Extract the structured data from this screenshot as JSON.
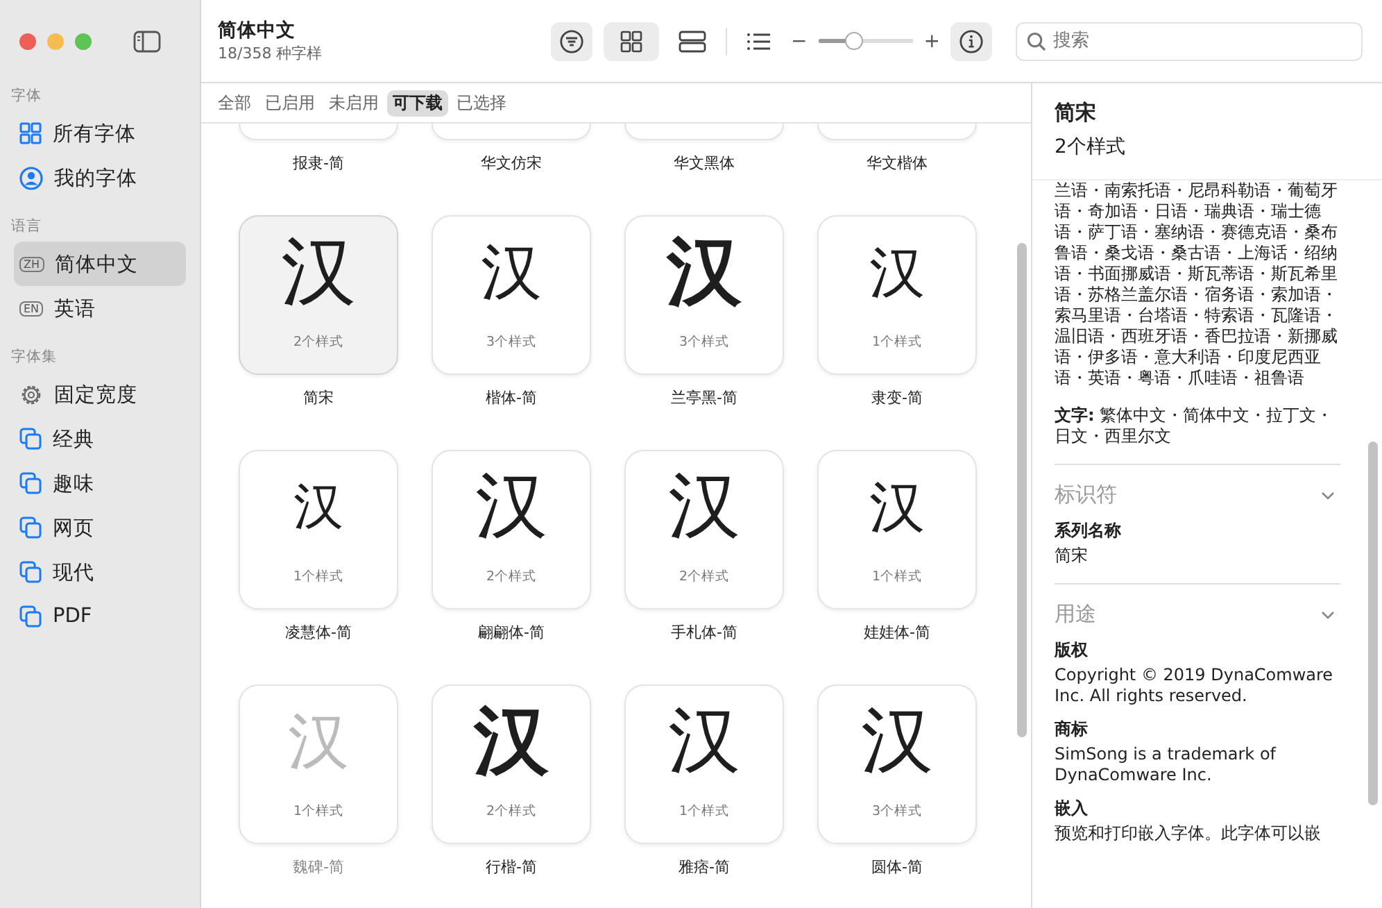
{
  "window": {
    "controls": [
      {
        "color": "#ee5f57"
      },
      {
        "color": "#f5bd4f"
      },
      {
        "color": "#5ec454"
      }
    ]
  },
  "sidebar": {
    "sections": [
      {
        "title": "字体",
        "items": [
          {
            "label": "所有字体",
            "kind": "grid",
            "selected": false
          },
          {
            "label": "我的字体",
            "kind": "person",
            "selected": false
          }
        ]
      },
      {
        "title": "语言",
        "items": [
          {
            "label": "简体中文",
            "kind": "badge",
            "badge": "ZH",
            "selected": true
          },
          {
            "label": "英语",
            "kind": "badge",
            "badge": "EN",
            "selected": false
          }
        ]
      },
      {
        "title": "字体集",
        "items": [
          {
            "label": "固定宽度",
            "kind": "gear",
            "selected": false
          },
          {
            "label": "经典",
            "kind": "collection",
            "selected": false
          },
          {
            "label": "趣味",
            "kind": "collection",
            "selected": false
          },
          {
            "label": "网页",
            "kind": "collection",
            "selected": false
          },
          {
            "label": "现代",
            "kind": "collection",
            "selected": false
          },
          {
            "label": "PDF",
            "kind": "collection",
            "selected": false
          }
        ]
      }
    ]
  },
  "toolbar": {
    "title": "简体中文",
    "subtitle": "18/358 种字样",
    "buttons": [
      {
        "kind": "filter",
        "on": true
      },
      {
        "kind": "grid",
        "on": true
      },
      {
        "kind": "rows",
        "on": false
      },
      {
        "kind": "list",
        "on": false
      }
    ],
    "size_slider": {
      "minus": "−",
      "plus": "+",
      "level": 0.38
    },
    "info_button": {
      "on": true
    },
    "search": {
      "placeholder": "搜索"
    }
  },
  "tabs": [
    {
      "label": "全部",
      "selected": false
    },
    {
      "label": "已启用",
      "selected": false
    },
    {
      "label": "未启用",
      "selected": false
    },
    {
      "label": "可下载",
      "selected": true
    },
    {
      "label": "已选择",
      "selected": false
    }
  ],
  "grid": {
    "cut_row": [
      {
        "name": "报隶-简"
      },
      {
        "name": "华文仿宋"
      },
      {
        "name": "华文黑体"
      },
      {
        "name": "华文楷体"
      }
    ],
    "cards": [
      {
        "sample": "汉",
        "kind": "song",
        "styles": "2个样式",
        "name": "简宋",
        "selected": true,
        "disabled": false
      },
      {
        "sample": "汉",
        "kind": "kai",
        "styles": "3个样式",
        "name": "楷体-简",
        "selected": false,
        "disabled": false
      },
      {
        "sample": "汉",
        "kind": "hei",
        "styles": "3个样式",
        "name": "兰亭黑-简",
        "selected": false,
        "disabled": false
      },
      {
        "sample": "汉",
        "kind": "li",
        "styles": "1个样式",
        "name": "隶变-简",
        "selected": false,
        "disabled": false
      },
      {
        "sample": "汉",
        "kind": "light",
        "styles": "1个样式",
        "name": "凌慧体-简",
        "selected": false,
        "disabled": false
      },
      {
        "sample": "汉",
        "kind": "round",
        "styles": "2个样式",
        "name": "翩翩体-简",
        "selected": false,
        "disabled": false
      },
      {
        "sample": "汉",
        "kind": "round",
        "styles": "2个样式",
        "name": "手札体-简",
        "selected": false,
        "disabled": false
      },
      {
        "sample": "汉",
        "kind": "li",
        "styles": "1个样式",
        "name": "娃娃体-简",
        "selected": false,
        "disabled": false
      },
      {
        "sample": "汉",
        "kind": "kai",
        "styles": "1个样式",
        "name": "魏碑-简",
        "selected": false,
        "disabled": true
      },
      {
        "sample": "汉",
        "kind": "hei",
        "styles": "2个样式",
        "name": "行楷-简",
        "selected": false,
        "disabled": false
      },
      {
        "sample": "汉",
        "kind": "round",
        "styles": "1个样式",
        "name": "雅痞-简",
        "selected": false,
        "disabled": false
      },
      {
        "sample": "汉",
        "kind": "round",
        "styles": "3个样式",
        "name": "圆体-简",
        "selected": false,
        "disabled": false
      }
    ]
  },
  "info": {
    "title": "简宋",
    "subtitle": "2个样式",
    "languages": "兰语・南索托语・尼昂科勒语・葡萄牙语・奇加语・日语・瑞典语・瑞士德语・萨丁语・塞纳语・赛德克语・桑布鲁语・桑戈语・桑古语・上海话・绍纳语・书面挪威语・斯瓦蒂语・斯瓦希里语・苏格兰盖尔语・宿务语・索加语・索马里语・台塔语・特索语・瓦隆语・温旧语・西班牙语・香巴拉语・新挪威语・伊多语・意大利语・印度尼西亚语・英语・粤语・爪哇语・祖鲁语",
    "scripts_label": "文字:",
    "scripts": "繁体中文・简体中文・拉丁文・日文・西里尔文",
    "sections": [
      {
        "title": "标识符",
        "fields": [
          {
            "label": "系列名称",
            "value": "简宋"
          }
        ]
      },
      {
        "title": "用途",
        "fields": [
          {
            "label": "版权",
            "value": "Copyright © 2019 DynaComware Inc. All rights reserved."
          },
          {
            "label": "商标",
            "value": "SimSong is a trademark of DynaComware Inc."
          },
          {
            "label": "嵌入",
            "value": "预览和打印嵌入字体。此字体可以嵌"
          }
        ]
      }
    ]
  }
}
